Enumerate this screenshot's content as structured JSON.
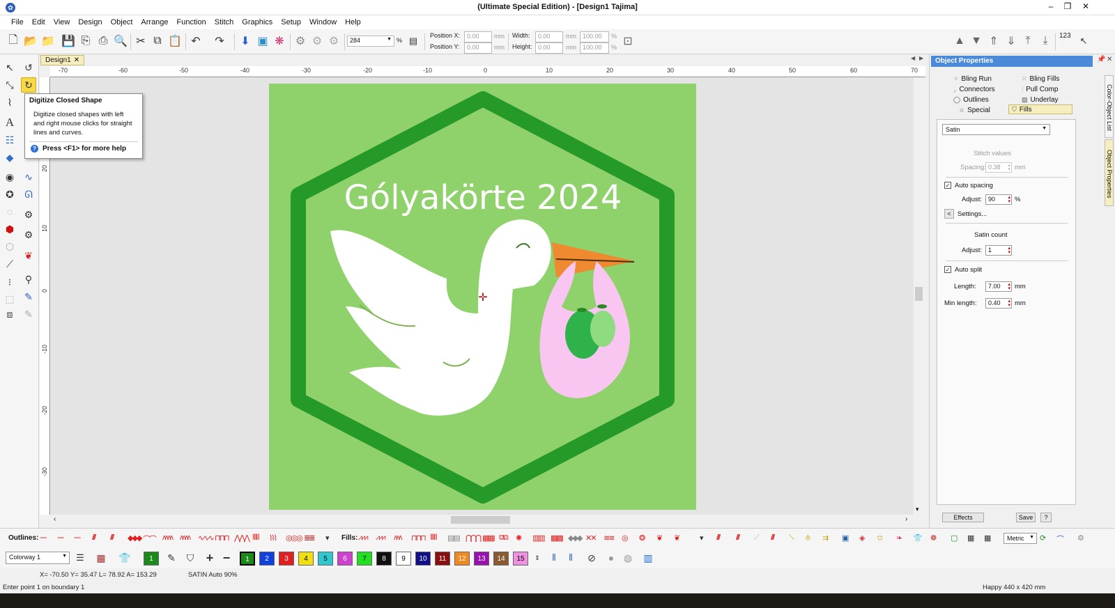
{
  "window": {
    "title": "(Ultimate Special Edition) - [Design1        Tajima]",
    "minimize": "–",
    "restore": "❐",
    "close": "✕"
  },
  "menu": [
    "File",
    "Edit",
    "View",
    "Design",
    "Object",
    "Arrange",
    "Function",
    "Stitch",
    "Graphics",
    "Setup",
    "Window",
    "Help"
  ],
  "toolbar": {
    "zoom": "284",
    "zoom_unit": "%",
    "position_x_label": "Position X:",
    "position_y_label": "Position Y:",
    "position_x": "0.00",
    "position_y": "0.00",
    "width_label": "Width:",
    "height_label": "Height:",
    "width": "0.00",
    "height": "0.00",
    "unit_mm": "mm",
    "scale_w": "100.00",
    "scale_h": "100.00",
    "scale_unit": "%",
    "counter_label": "123"
  },
  "document_tab": {
    "label": "Design1",
    "close": "✕"
  },
  "ruler": {
    "h": [
      "-70",
      "-60",
      "-50",
      "-40",
      "-30",
      "-20",
      "-10",
      "0",
      "10",
      "20",
      "30",
      "40",
      "50",
      "60",
      "70"
    ],
    "v": [
      "20",
      "10",
      "0",
      "-10",
      "-20",
      "-30"
    ]
  },
  "design": {
    "text": "Gólyakörte 2024",
    "background_color": "#8fd16a",
    "hex_color": "#259a28"
  },
  "tooltip": {
    "title": "Digitize Closed Shape",
    "body": "Digitize closed shapes with left and right mouse clicks for straight lines and curves.",
    "help": "Press <F1> for more help"
  },
  "object_properties": {
    "title": "Object Properties",
    "tabs": [
      "Bling Run",
      "Bling Fills",
      "Connectors",
      "Pull Comp",
      "Outlines",
      "Underlay",
      "Special",
      "Fills"
    ],
    "active_tab": "Fills",
    "fill_type": "Satin",
    "stitch_values_label": "Stitch values",
    "spacing_label": "Spacing:",
    "spacing_value": "0.38",
    "mm": "mm",
    "auto_spacing_label": "Auto spacing",
    "auto_spacing_checked": true,
    "adjust_label": "Adjust:",
    "adjust_value": "90",
    "percent": "%",
    "settings_button": "Settings...",
    "settings_arrow": "<",
    "satin_count_label": "Satin count",
    "satin_adjust_value": "1",
    "auto_split_label": "Auto split",
    "auto_split_checked": true,
    "length_label": "Length:",
    "length_value": "7.00",
    "min_length_label": "Min length:",
    "min_length_value": "0.40",
    "effects_button": "Effects",
    "save_button": "Save",
    "help_button": "?",
    "side_tabs": [
      "Color-Object List",
      "Object Properties"
    ]
  },
  "fills_bar": {
    "outlines_label": "Outlines:",
    "fills_label": "Fills:"
  },
  "colorway": {
    "label": "Colorway 1",
    "units": "Metric",
    "swatches": [
      {
        "n": "1",
        "color": "#1a8a1a"
      },
      {
        "n": "1",
        "color": "#1a8a1a"
      },
      {
        "n": "2",
        "color": "#1040e0"
      },
      {
        "n": "3",
        "color": "#e02020"
      },
      {
        "n": "4",
        "color": "#f0e010"
      },
      {
        "n": "5",
        "color": "#30c8d0"
      },
      {
        "n": "6",
        "color": "#d040d0"
      },
      {
        "n": "7",
        "color": "#20e020"
      },
      {
        "n": "8",
        "color": "#111111"
      },
      {
        "n": "9",
        "color": "#ffffff"
      },
      {
        "n": "10",
        "color": "#10108a"
      },
      {
        "n": "11",
        "color": "#8a1010"
      },
      {
        "n": "12",
        "color": "#f08a20"
      },
      {
        "n": "13",
        "color": "#9a10b0"
      },
      {
        "n": "14",
        "color": "#8a5a30"
      },
      {
        "n": "15",
        "color": "#f090e0"
      }
    ]
  },
  "status": {
    "coords": "X= -70.50 Y= 35.47 L= 78.92 A= 153.29",
    "stitch": "SATIN Auto 90%",
    "prompt": "Enter point 1 on boundary 1",
    "hoop": "Happy 440 x 420 mm"
  }
}
